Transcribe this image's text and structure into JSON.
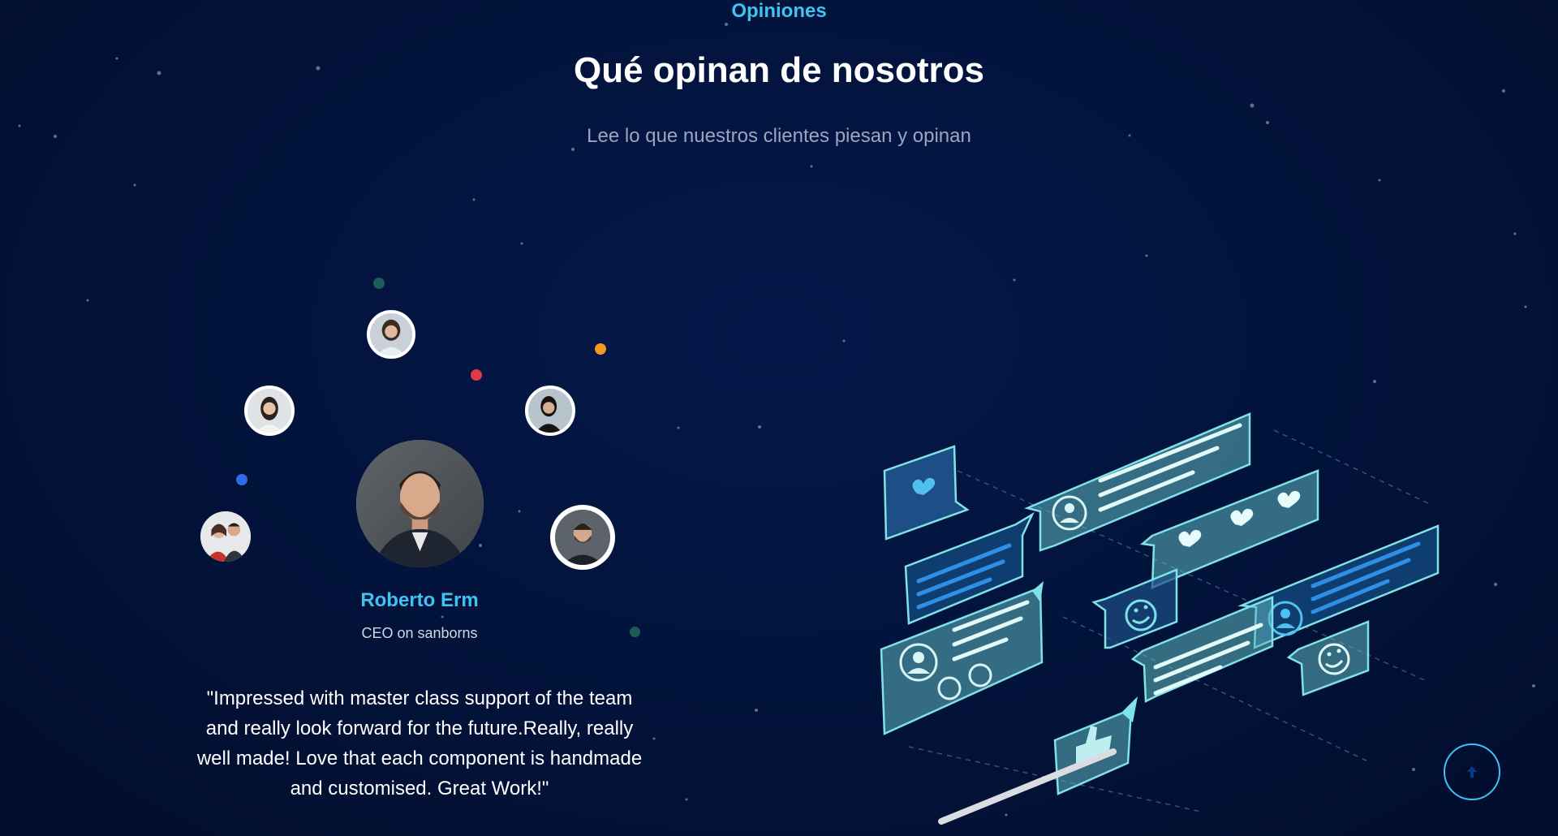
{
  "section": {
    "eyebrow": "Opiniones",
    "title": "Qué opinan de nosotros",
    "subtitle": "Lee lo que nuestros clientes piesan y opinan"
  },
  "testimonial": {
    "name": "Roberto Erm",
    "role": "CEO on sanborns",
    "quote": "\"Impressed with master class support of the team and really look forward for the future.Really, really well made! Love that each component is handmade and customised. Great Work!\""
  },
  "avatars": [
    {
      "icon": "woman-avatar-icon"
    },
    {
      "icon": "woman-avatar-icon"
    },
    {
      "icon": "woman-avatar-icon"
    },
    {
      "icon": "couple-avatar-icon"
    },
    {
      "icon": "man-avatar-icon"
    }
  ],
  "scroll_top": {
    "icon": "arrow-up-icon"
  },
  "colors": {
    "background": "#021238",
    "accent": "#3fc3f2",
    "illustration_teal": "#7fe3e6",
    "illustration_blue": "#2d8fe6",
    "dot_red": "#e03a48",
    "dot_orange": "#f39a1e",
    "dot_blue": "#2d6be8",
    "dot_teal": "#1d5a5a"
  }
}
